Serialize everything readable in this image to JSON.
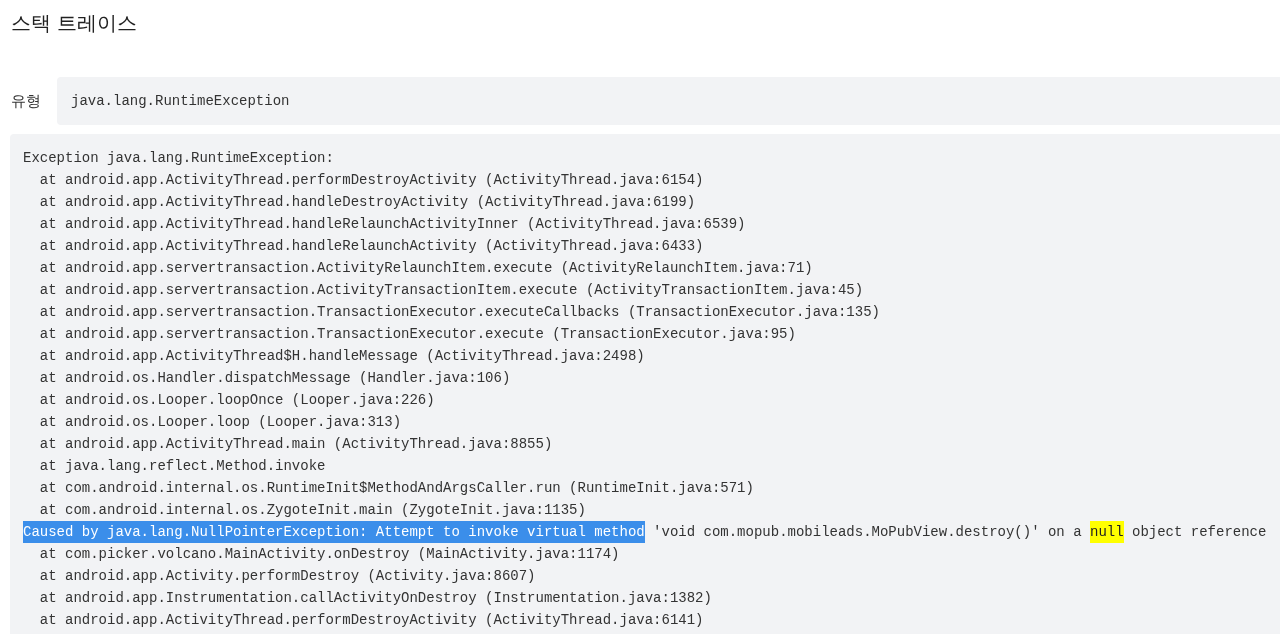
{
  "title": "스택 트레이스",
  "type_field": {
    "label": "유형",
    "value": "java.lang.RuntimeException"
  },
  "stack_trace": [
    {
      "segments": [
        {
          "text": "Exception java.lang.RuntimeException:",
          "kind": "plain"
        }
      ]
    },
    {
      "segments": [
        {
          "text": "  at android.app.ActivityThread.performDestroyActivity (ActivityThread.java:6154)",
          "kind": "plain"
        }
      ]
    },
    {
      "segments": [
        {
          "text": "  at android.app.ActivityThread.handleDestroyActivity (ActivityThread.java:6199)",
          "kind": "plain"
        }
      ]
    },
    {
      "segments": [
        {
          "text": "  at android.app.ActivityThread.handleRelaunchActivityInner (ActivityThread.java:6539)",
          "kind": "plain"
        }
      ]
    },
    {
      "segments": [
        {
          "text": "  at android.app.ActivityThread.handleRelaunchActivity (ActivityThread.java:6433)",
          "kind": "plain"
        }
      ]
    },
    {
      "segments": [
        {
          "text": "  at android.app.servertransaction.ActivityRelaunchItem.execute (ActivityRelaunchItem.java:71)",
          "kind": "plain"
        }
      ]
    },
    {
      "segments": [
        {
          "text": "  at android.app.servertransaction.ActivityTransactionItem.execute (ActivityTransactionItem.java:45)",
          "kind": "plain"
        }
      ]
    },
    {
      "segments": [
        {
          "text": "  at android.app.servertransaction.TransactionExecutor.executeCallbacks (TransactionExecutor.java:135)",
          "kind": "plain"
        }
      ]
    },
    {
      "segments": [
        {
          "text": "  at android.app.servertransaction.TransactionExecutor.execute (TransactionExecutor.java:95)",
          "kind": "plain"
        }
      ]
    },
    {
      "segments": [
        {
          "text": "  at android.app.ActivityThread$H.handleMessage (ActivityThread.java:2498)",
          "kind": "plain"
        }
      ]
    },
    {
      "segments": [
        {
          "text": "  at android.os.Handler.dispatchMessage (Handler.java:106)",
          "kind": "plain"
        }
      ]
    },
    {
      "segments": [
        {
          "text": "  at android.os.Looper.loopOnce (Looper.java:226)",
          "kind": "plain"
        }
      ]
    },
    {
      "segments": [
        {
          "text": "  at android.os.Looper.loop (Looper.java:313)",
          "kind": "plain"
        }
      ]
    },
    {
      "segments": [
        {
          "text": "  at android.app.ActivityThread.main (ActivityThread.java:8855)",
          "kind": "plain"
        }
      ]
    },
    {
      "segments": [
        {
          "text": "  at java.lang.reflect.Method.invoke",
          "kind": "plain"
        }
      ]
    },
    {
      "segments": [
        {
          "text": "  at com.android.internal.os.RuntimeInit$MethodAndArgsCaller.run (RuntimeInit.java:571)",
          "kind": "plain"
        }
      ]
    },
    {
      "segments": [
        {
          "text": "  at com.android.internal.os.ZygoteInit.main (ZygoteInit.java:1135)",
          "kind": "plain"
        }
      ]
    },
    {
      "segments": [
        {
          "text": "Caused by java.lang.NullPointerException: Attempt to invoke virtual method",
          "kind": "selection"
        },
        {
          "text": " 'void com.mopub.mobileads.MoPubView.destroy()' on a ",
          "kind": "plain"
        },
        {
          "text": "null",
          "kind": "search"
        },
        {
          "text": " object reference",
          "kind": "plain"
        }
      ]
    },
    {
      "segments": [
        {
          "text": "  at com.picker.volcano.MainActivity.onDestroy (MainActivity.java:1174)",
          "kind": "plain"
        }
      ]
    },
    {
      "segments": [
        {
          "text": "  at android.app.Activity.performDestroy (Activity.java:8607)",
          "kind": "plain"
        }
      ]
    },
    {
      "segments": [
        {
          "text": "  at android.app.Instrumentation.callActivityOnDestroy (Instrumentation.java:1382)",
          "kind": "plain"
        }
      ]
    },
    {
      "segments": [
        {
          "text": "  at android.app.ActivityThread.performDestroyActivity (ActivityThread.java:6141)",
          "kind": "plain"
        }
      ]
    }
  ]
}
